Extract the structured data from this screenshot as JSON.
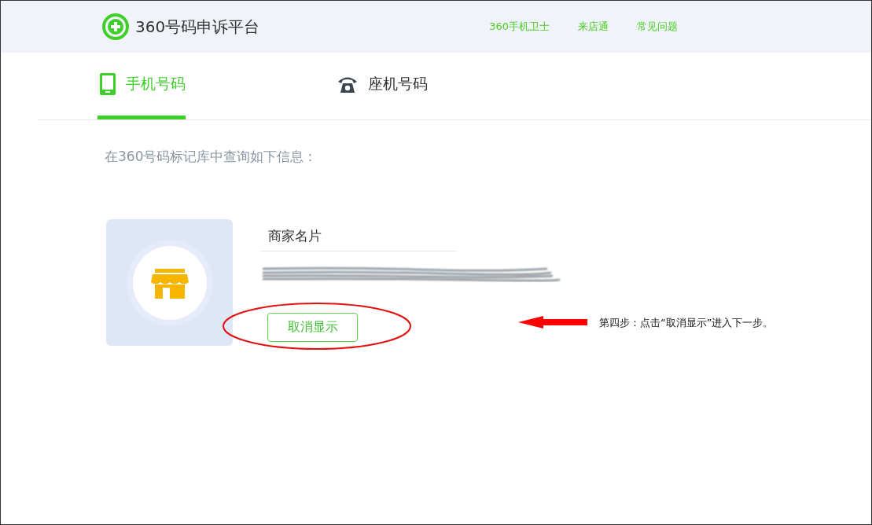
{
  "header": {
    "logo_text": "360号码申诉平台",
    "nav": [
      {
        "label": "360手机卫士"
      },
      {
        "label": "来店通"
      },
      {
        "label": "常见问题"
      }
    ]
  },
  "tabs": [
    {
      "label": "手机号码",
      "kind": "mobile",
      "selected": true
    },
    {
      "label": "座机号码",
      "kind": "landline",
      "selected": false
    }
  ],
  "description": "在360号码标记库中查询如下信息：",
  "card": {
    "title": "商家名片",
    "button": "取消显示"
  },
  "annotation": {
    "text": "第四步：点击“取消显示”进入下一步。"
  }
}
